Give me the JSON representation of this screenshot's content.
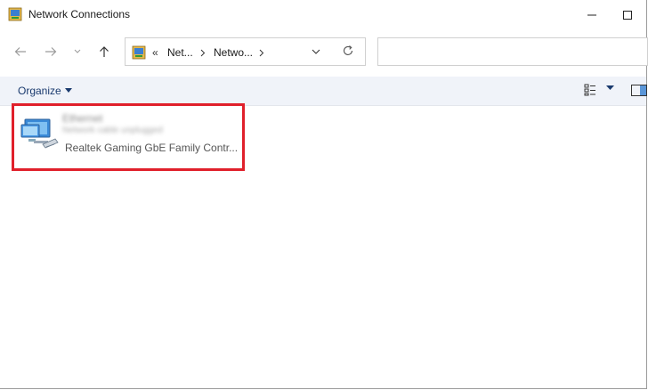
{
  "window": {
    "title": "Network Connections",
    "icon": "network-connections-icon"
  },
  "nav": {
    "back_icon": "arrow-left-icon",
    "forward_icon": "arrow-right-icon",
    "recent_icon": "chevron-down-icon",
    "up_icon": "arrow-up-icon"
  },
  "address": {
    "overflow": "«",
    "crumbs": [
      "Net...",
      "Netwo..."
    ],
    "refresh_icon": "refresh-icon"
  },
  "search": {
    "placeholder": ""
  },
  "toolbar": {
    "organize_label": "Organize",
    "view_icon": "view-options-icon",
    "pane_icon": "preview-pane-icon"
  },
  "items": [
    {
      "name": "Ethernet",
      "status": "Network cable unplugged",
      "device": "Realtek Gaming GbE Family Contr...",
      "icon": "ethernet-adapter-icon"
    }
  ],
  "colors": {
    "highlight": "#e0202b",
    "toolbar_bg": "#f0f3f9",
    "link": "#1a3a6e"
  }
}
